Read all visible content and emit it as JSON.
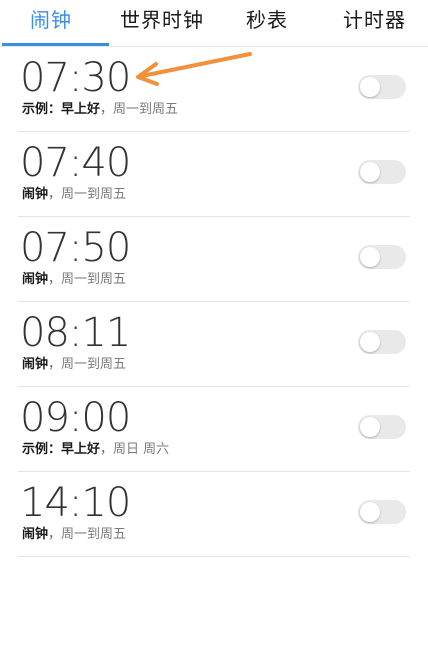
{
  "tabs": [
    {
      "label": "闹钟",
      "active": true
    },
    {
      "label": "世界时钟",
      "active": false
    },
    {
      "label": "秒表",
      "active": false
    },
    {
      "label": "计时器",
      "active": false
    }
  ],
  "alarms": [
    {
      "time": "07:30",
      "label": "示例：早上好",
      "separator": "，",
      "repeat": "周一到周五",
      "enabled": false
    },
    {
      "time": "07:40",
      "label": "闹钟",
      "separator": "，",
      "repeat": "周一到周五",
      "enabled": false
    },
    {
      "time": "07:50",
      "label": "闹钟",
      "separator": "，",
      "repeat": "周一到周五",
      "enabled": false
    },
    {
      "time": "08:11",
      "label": "闹钟",
      "separator": "，",
      "repeat": "周一到周五",
      "enabled": false
    },
    {
      "time": "09:00",
      "label": "示例：早上好",
      "separator": "，",
      "repeat": "周日 周六",
      "enabled": false
    },
    {
      "time": "14:10",
      "label": "闹钟",
      "separator": "，",
      "repeat": "周一到周五",
      "enabled": false
    }
  ],
  "colors": {
    "accent": "#3a8ee6",
    "annotation_arrow": "#f0913b",
    "toggle_off": "#e9e9e9"
  },
  "icons": {
    "annotation": "arrow-left-icon"
  }
}
